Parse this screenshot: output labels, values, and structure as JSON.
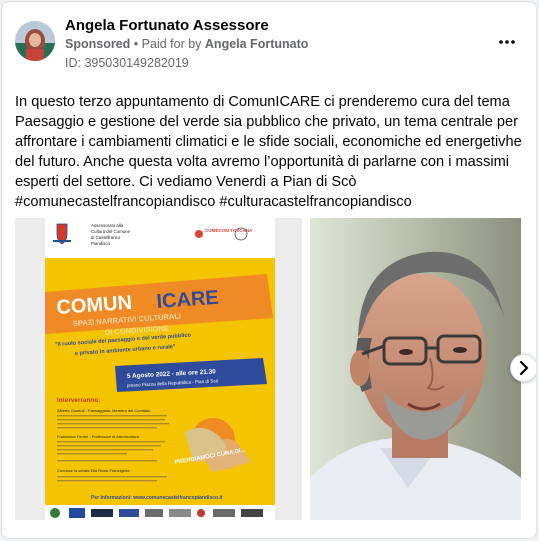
{
  "header": {
    "page_name": "Angela Fortunato Assessore",
    "sponsored": "Sponsored",
    "separator": "•",
    "paid_for_prefix": "Paid for by",
    "paid_for_name": "Angela Fortunato",
    "ad_id": "ID: 395030149282019",
    "more_icon": "more-horizontal-icon"
  },
  "post": {
    "text": "In questo terzo appuntamento di ComunICARE ci prenderemo cura del tema Paesaggio e gestione del verde sia pubblico che privato, un tema centrale per affrontare i cambiamenti climatici e le sfide sociali, economiche ed energetivhe del futuro. Anche questa volta avremo l’opportunità di parlarne con i massimi esperti del settore. Ci vediamo Venerdì a Pian di Scò #comunecastelfrancopiandisco #culturacastelfrancopiandisco"
  },
  "poster": {
    "org_line1": "Assessorato alla",
    "org_line2": "Cultura del Comune",
    "org_line3": "di Castelfranco",
    "org_line4": "Piandiscò",
    "title_comun": "COMUN",
    "title_icare": "ICARE",
    "subtitle1": "SPAZI NARRATIVI CULTURALI",
    "subtitle2": "DI CONDIVISIONE",
    "theme1": "\"Il ruolo sociale del paesaggio e del verde pubblico",
    "theme2": "e privato in ambiente urbano e rurale\"",
    "date": "5 Agosto 2022 - alle ore 21.30",
    "place": "presso Piazza della Repubblica - Pian di Scò",
    "speakers_heading": "Interverranno:",
    "speaker1": "Alberto Giuntoli - Paesaggista, Membro del Comitato",
    "speaker2": "Francesco Ferrini - Professore di Arboricoltura",
    "moderator": "Conduce la serata Elia Rossi Francigena",
    "stamp": "PRENDIAMOCI CURA DI...",
    "info": "Per informazioni: www.comunecastelfrancopiandisco.it",
    "sponsor_logo_text": "COMECOM TOSCANA"
  },
  "colors": {
    "text": "#050505",
    "meta": "#65676b",
    "poster_yellow": "#f5c400",
    "poster_orange": "#f08a24",
    "poster_blue": "#2f4b9b"
  },
  "media": {
    "photo_label": "portrait-photo",
    "next_icon": "chevron-right-icon"
  }
}
